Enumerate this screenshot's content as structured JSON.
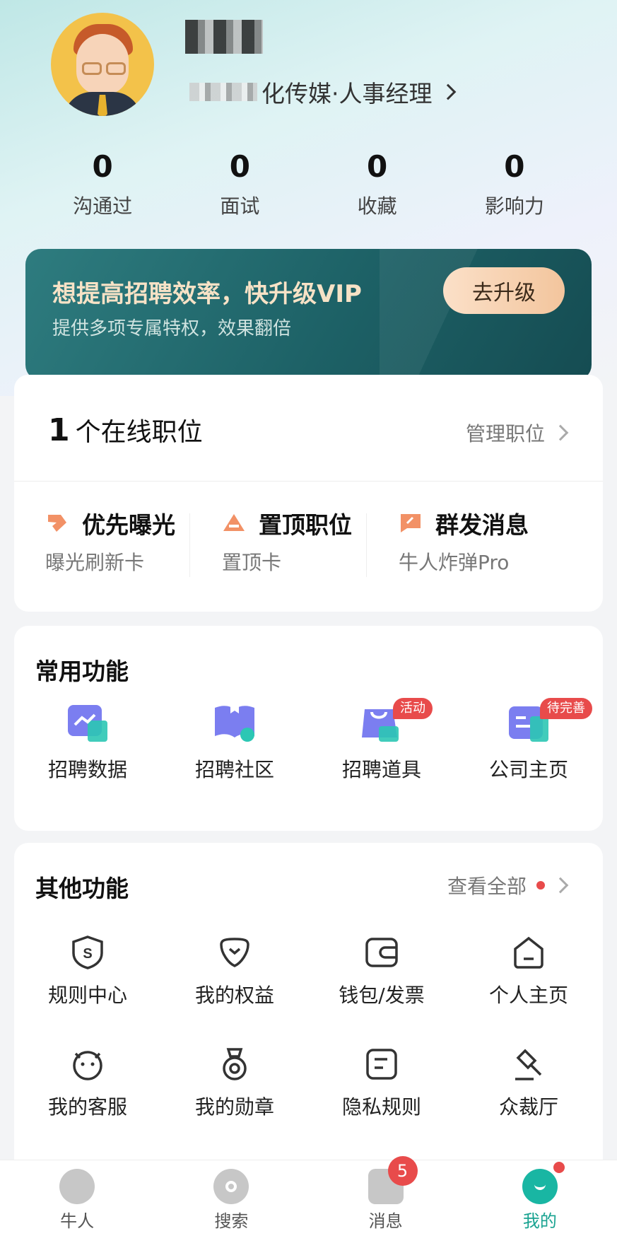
{
  "profile": {
    "company_title": "化传媒·人事经理",
    "stats": [
      {
        "value": "0",
        "label": "沟通过"
      },
      {
        "value": "0",
        "label": "面试"
      },
      {
        "value": "0",
        "label": "收藏"
      },
      {
        "value": "0",
        "label": "影响力"
      }
    ]
  },
  "vip": {
    "title": "想提高招聘效率，快升级VIP",
    "subtitle": "提供多项专属特权，效果翻倍",
    "button": "去升级"
  },
  "jobs": {
    "count": "1",
    "count_suffix": "个在线职位",
    "manage": "管理职位",
    "promos": [
      {
        "title": "优先曝光",
        "sub": "曝光刷新卡",
        "icon": "exposure-icon"
      },
      {
        "title": "置顶职位",
        "sub": "置顶卡",
        "icon": "pin-top-icon"
      },
      {
        "title": "群发消息",
        "sub": "牛人炸弹Pro",
        "icon": "broadcast-icon"
      }
    ]
  },
  "common": {
    "title": "常用功能",
    "items": [
      {
        "label": "招聘数据",
        "badge": "",
        "icon": "recruit-data-icon"
      },
      {
        "label": "招聘社区",
        "badge": "",
        "icon": "community-icon"
      },
      {
        "label": "招聘道具",
        "badge": "活动",
        "icon": "tools-bag-icon"
      },
      {
        "label": "公司主页",
        "badge": "待完善",
        "icon": "company-page-icon"
      }
    ]
  },
  "other": {
    "title": "其他功能",
    "more": "查看全部",
    "items": [
      {
        "label": "规则中心",
        "icon": "shield-icon"
      },
      {
        "label": "我的权益",
        "icon": "benefits-icon"
      },
      {
        "label": "钱包/发票",
        "icon": "wallet-icon"
      },
      {
        "label": "个人主页",
        "icon": "home-icon"
      },
      {
        "label": "我的客服",
        "icon": "service-icon"
      },
      {
        "label": "我的勋章",
        "icon": "medal-icon"
      },
      {
        "label": "隐私规则",
        "icon": "privacy-icon"
      },
      {
        "label": "众裁厅",
        "icon": "court-icon"
      }
    ]
  },
  "tabbar": [
    {
      "label": "牛人",
      "icon": "talent-icon",
      "badge": ""
    },
    {
      "label": "搜索",
      "icon": "search-icon",
      "badge": ""
    },
    {
      "label": "消息",
      "icon": "message-icon",
      "badge": "5"
    },
    {
      "label": "我的",
      "icon": "me-icon",
      "badge": ""
    }
  ],
  "colors": {
    "accent": "#19b6a3",
    "badge": "#e84b4b",
    "vip_bg": "#1d6166"
  }
}
